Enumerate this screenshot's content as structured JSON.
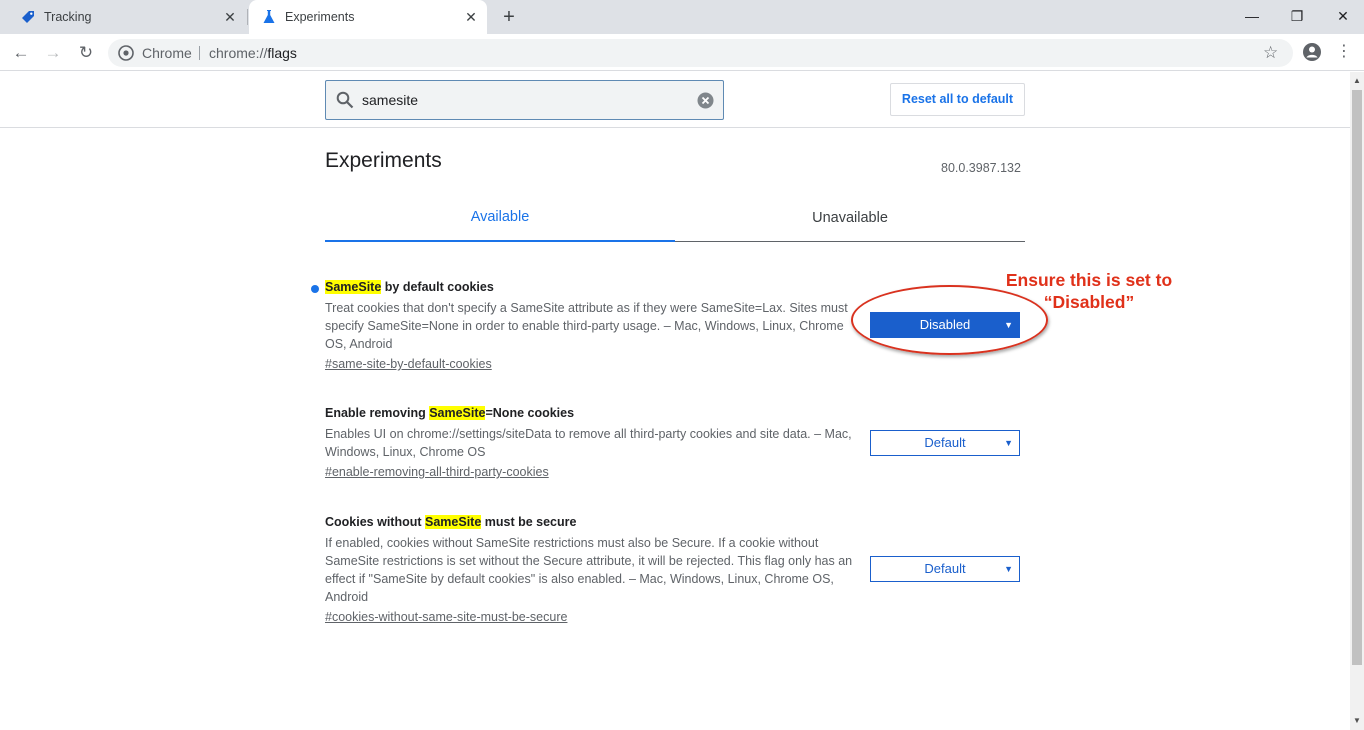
{
  "tabs": [
    {
      "title": "Tracking",
      "icon": "tag-icon"
    },
    {
      "title": "Experiments",
      "icon": "flask-icon"
    }
  ],
  "window_controls": {
    "minimize": "—",
    "restore": "❐",
    "close": "✕"
  },
  "toolbar": {
    "back": "←",
    "forward": "→",
    "reload": "↻",
    "chip": "Chrome",
    "url_scheme": "chrome://",
    "url_path": "flags",
    "star": "☆",
    "menu": "⋮"
  },
  "search": {
    "value": "samesite"
  },
  "reset_label": "Reset all to default",
  "page_title": "Experiments",
  "version": "80.0.3987.132",
  "page_tabs": {
    "available": "Available",
    "unavailable": "Unavailable"
  },
  "flags": [
    {
      "title_highlight": "SameSite",
      "title_rest": " by default cookies",
      "description": "Treat cookies that don't specify a SameSite attribute as if they were SameSite=Lax. Sites must specify SameSite=None in order to enable third-party usage. – Mac, Windows, Linux, Chrome OS, Android",
      "link": "#same-site-by-default-cookies",
      "selected": "Disabled"
    },
    {
      "title_pre": "Enable removing ",
      "title_highlight": "SameSite",
      "title_rest": "=None cookies",
      "description": "Enables UI on chrome://settings/siteData to remove all third-party cookies and site data. – Mac, Windows, Linux, Chrome OS",
      "link": "#enable-removing-all-third-party-cookies",
      "selected": "Default"
    },
    {
      "title_pre": "Cookies without ",
      "title_highlight": "SameSite",
      "title_rest": " must be secure",
      "description": "If enabled, cookies without SameSite restrictions must also be Secure. If a cookie without SameSite restrictions is set without the Secure attribute, it will be rejected. This flag only has an effect if \"SameSite by default cookies\" is also enabled. – Mac, Windows, Linux, Chrome OS, Android",
      "link": "#cookies-without-same-site-must-be-secure",
      "selected": "Default"
    }
  ],
  "callout": {
    "line1": "Ensure this is set to",
    "line2": "“Disabled”"
  },
  "colors": {
    "accent": "#1a73e8",
    "select_blue": "#1a5fcc",
    "highlight": "#ffff00",
    "callout_red": "#e0311a"
  }
}
